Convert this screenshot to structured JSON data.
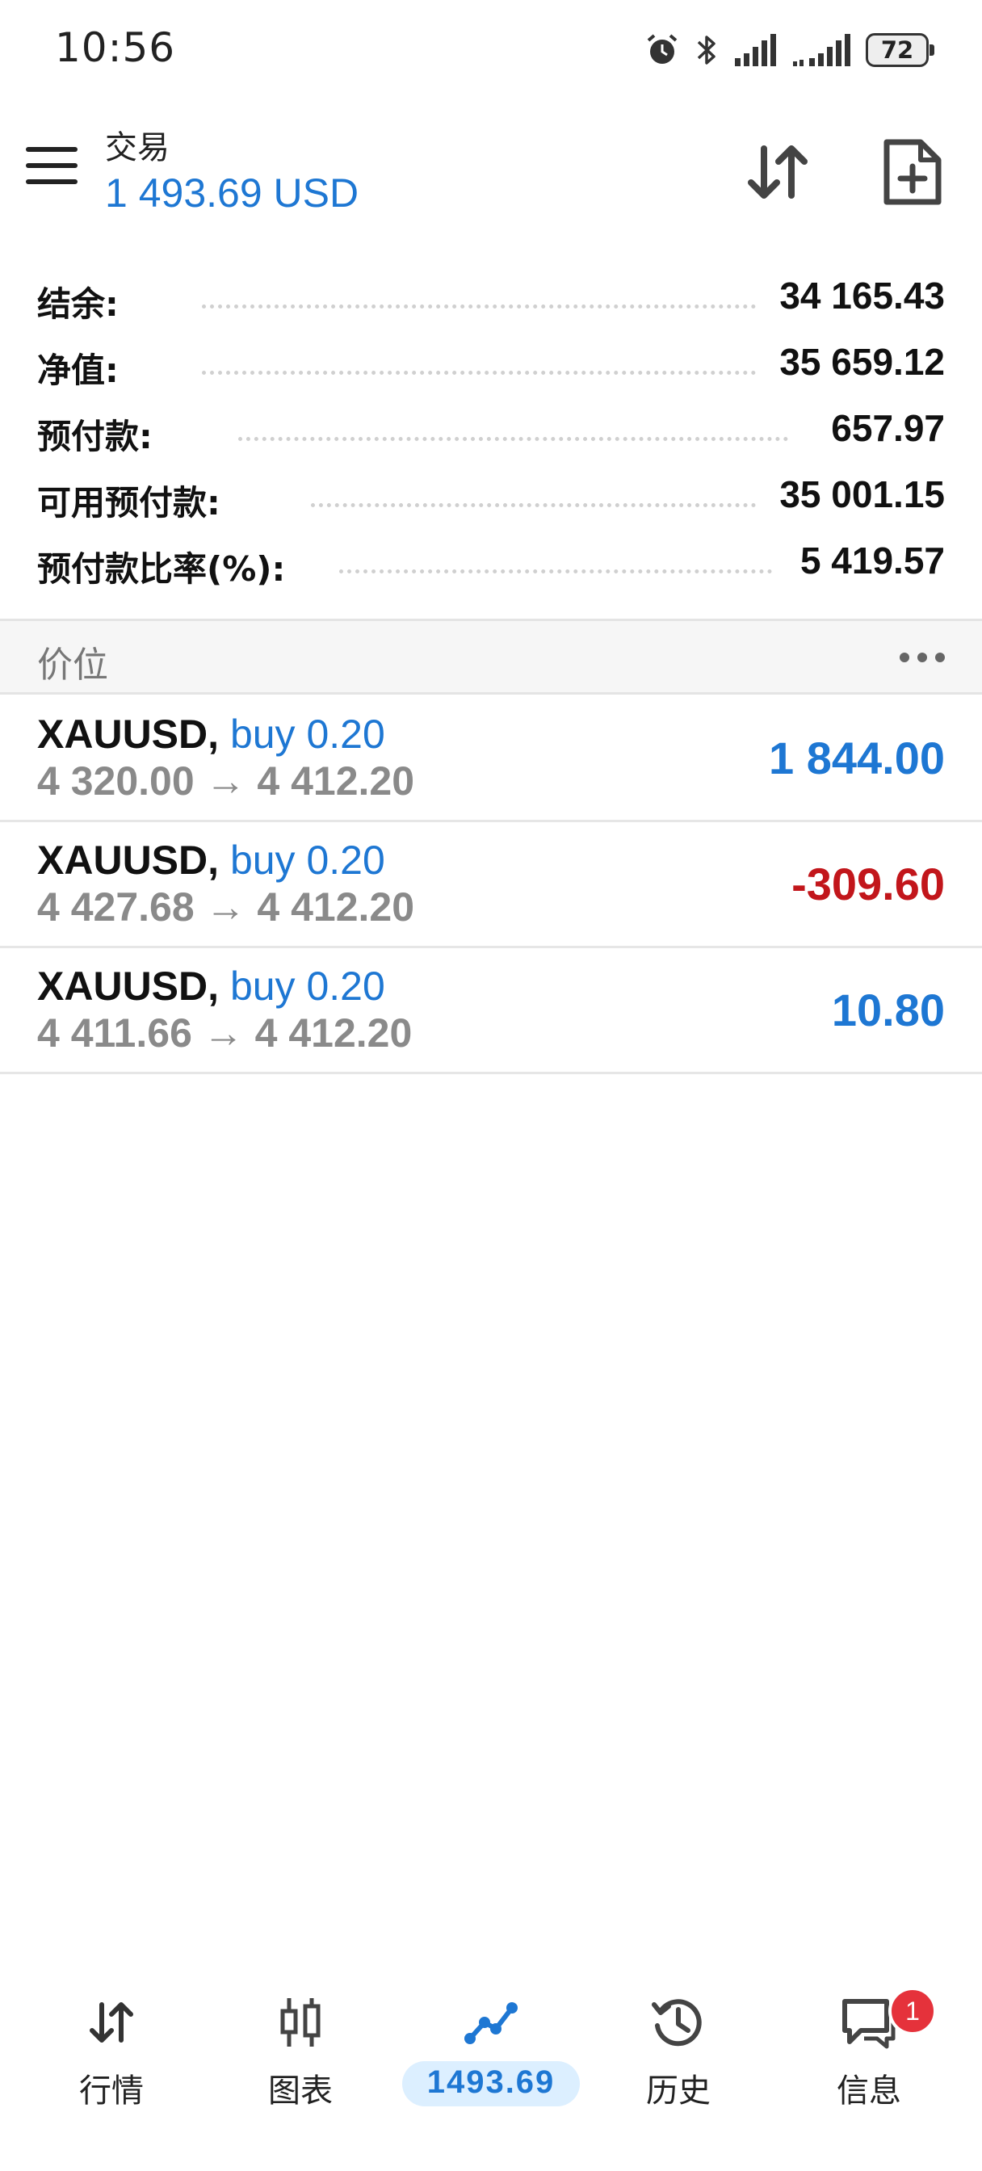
{
  "status_bar": {
    "time": "10:56",
    "battery": "72",
    "icons": [
      "alarm-icon",
      "bluetooth-icon",
      "signal-icon",
      "signal-icon",
      "battery-icon"
    ]
  },
  "header": {
    "title": "交易",
    "balance": "1 493.69 USD",
    "icons": [
      "menu-icon",
      "sort-icon",
      "new-order-icon"
    ]
  },
  "summary": [
    {
      "label": "结余:",
      "value": "34 165.43"
    },
    {
      "label": "净值:",
      "value": "35 659.12"
    },
    {
      "label": "预付款:",
      "value": "657.97"
    },
    {
      "label": "可用预付款:",
      "value": "35 001.15"
    },
    {
      "label": "预付款比率(%):",
      "value": "5 419.57"
    }
  ],
  "positions_section": {
    "title": "价位",
    "more_icon": "more-icon"
  },
  "positions": [
    {
      "symbol": "XAUUSD,",
      "type": "buy 0.20",
      "prices": "4 320.00 → 4 412.20",
      "profit": "1 844.00"
    },
    {
      "symbol": "XAUUSD,",
      "type": "buy 0.20",
      "prices": "4 427.68 → 4 412.20",
      "profit": "-309.60"
    },
    {
      "symbol": "XAUUSD,",
      "type": "buy 0.20",
      "prices": "4 411.66 → 4 412.20",
      "profit": "10.80"
    }
  ],
  "bottom_nav": {
    "items": [
      {
        "label": "行情",
        "icon": "quotes-icon"
      },
      {
        "label": "图表",
        "icon": "chart-icon"
      },
      {
        "label": "1493.69",
        "icon": "trade-icon",
        "active": true
      },
      {
        "label": "历史",
        "icon": "history-icon"
      },
      {
        "label": "信息",
        "icon": "messages-icon",
        "badge": "1"
      }
    ]
  },
  "colors": {
    "accent": "#1e77d3",
    "negative": "#c2161b",
    "badge": "#e5323b",
    "active_pill": "#dcefff"
  }
}
